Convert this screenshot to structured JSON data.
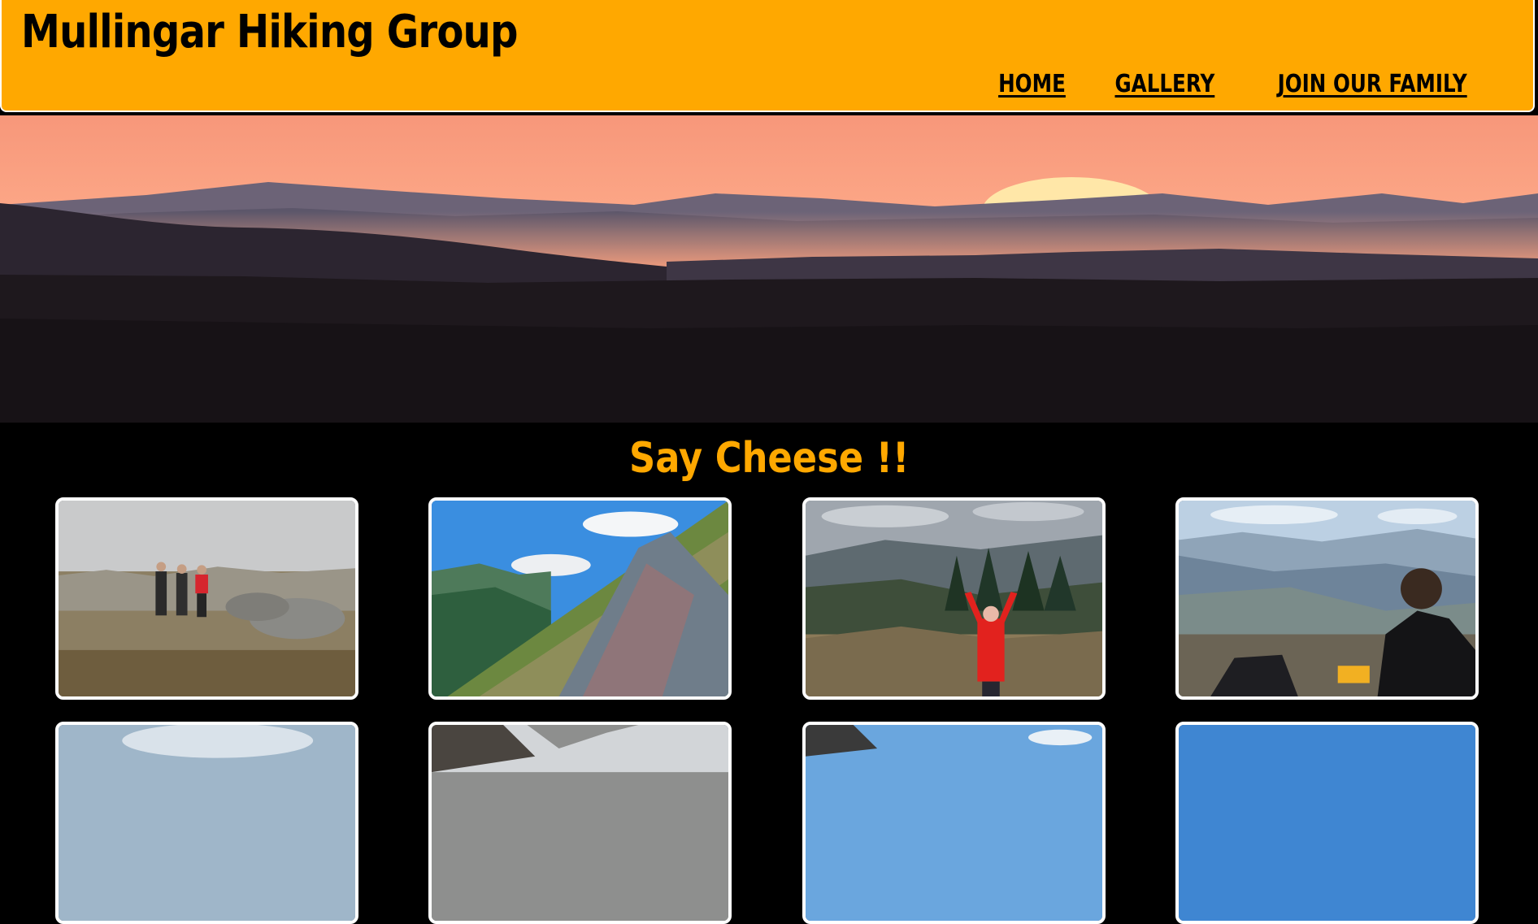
{
  "site": {
    "title": "Mullingar Hiking Group"
  },
  "nav": {
    "items": [
      {
        "label": "HOME"
      },
      {
        "label": "GALLERY"
      },
      {
        "label": "JOIN OUR FAMILY"
      }
    ]
  },
  "gallery": {
    "heading": "Say Cheese !!"
  },
  "colors": {
    "accent": "#FFA800",
    "background": "#000000",
    "photo_border": "#FFFFFF"
  }
}
